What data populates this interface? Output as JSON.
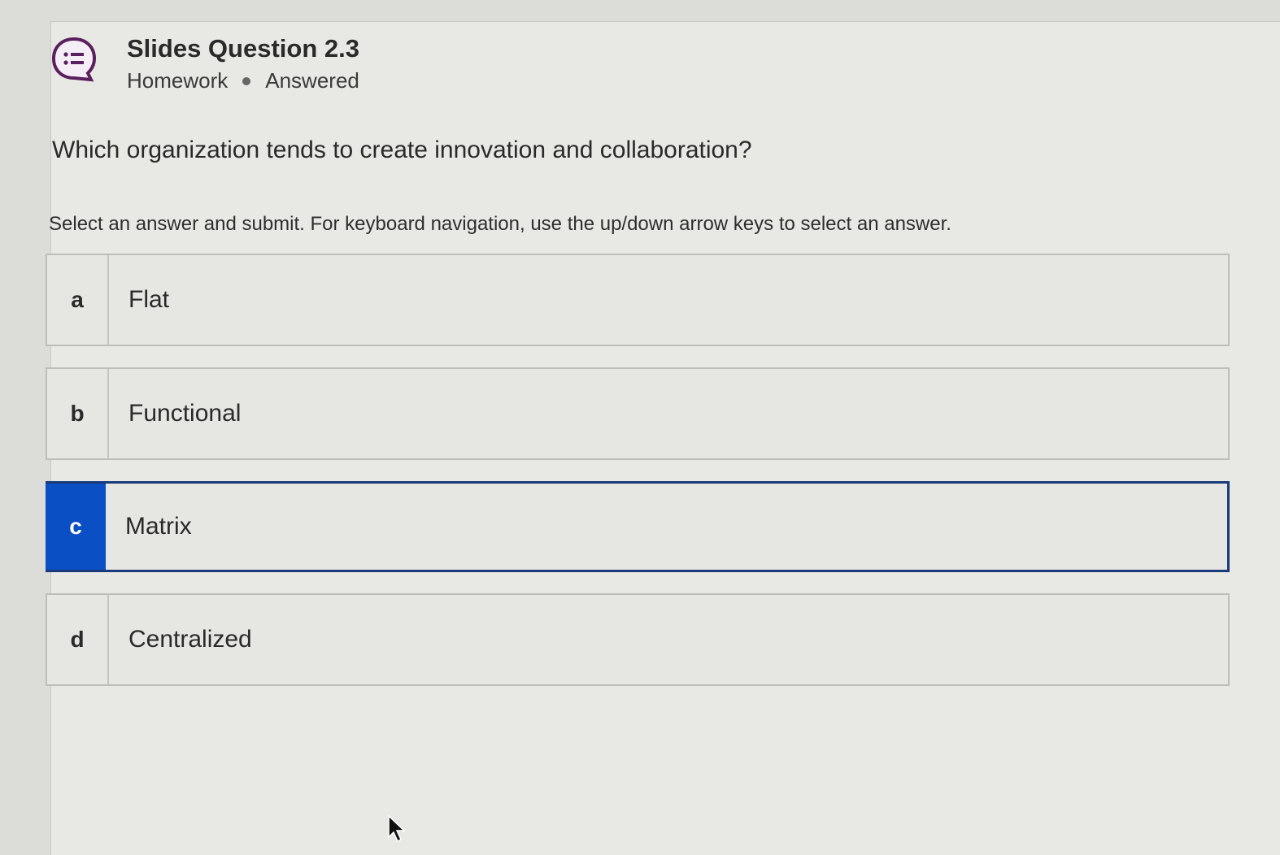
{
  "header": {
    "title": "Slides Question 2.3",
    "category": "Homework",
    "status": "Answered",
    "icon": "chat-list-icon"
  },
  "question": {
    "prompt": "Which organization tends to create innovation and collaboration?",
    "instructions": "Select an answer and submit. For keyboard navigation, use the up/down arrow keys to select an answer."
  },
  "options": [
    {
      "letter": "a",
      "label": "Flat",
      "selected": false
    },
    {
      "letter": "b",
      "label": "Functional",
      "selected": false
    },
    {
      "letter": "c",
      "label": "Matrix",
      "selected": true
    },
    {
      "letter": "d",
      "label": "Centralized",
      "selected": false
    }
  ],
  "colors": {
    "accent": "#0a4fc4",
    "icon_purple": "#5a1f5e"
  }
}
